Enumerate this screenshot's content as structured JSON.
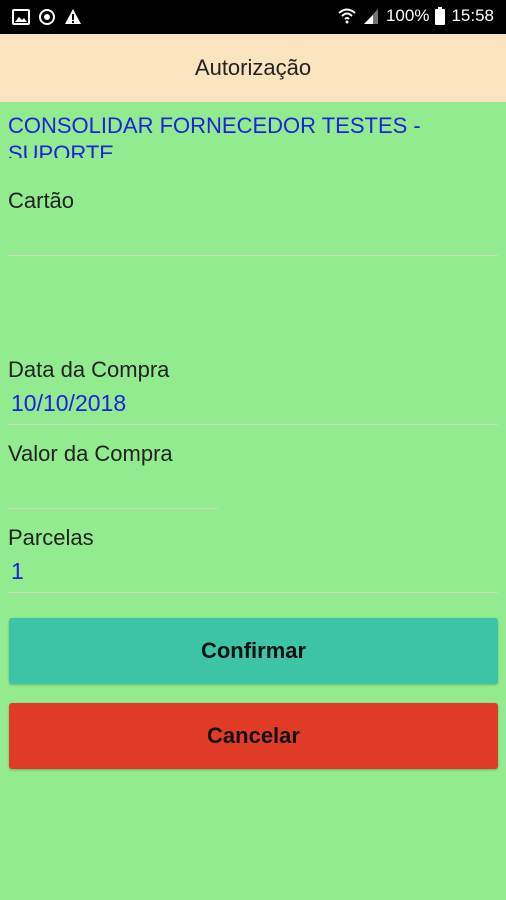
{
  "status_bar": {
    "battery": "100%",
    "time": "15:58",
    "left_icons": [
      "image-icon",
      "sync-icon",
      "warning-icon"
    ],
    "right_icons": [
      "wifi-icon",
      "signal-icon",
      "battery-icon"
    ]
  },
  "app_bar": {
    "title": "Autorização"
  },
  "form": {
    "supplier": "CONSOLIDAR FORNECEDOR TESTES - SUPORTE",
    "card_label": "Cartão",
    "card_value": "",
    "date_label": "Data da Compra",
    "date_value": "10/10/2018",
    "amount_label": "Valor da Compra",
    "amount_value": "",
    "installments_label": "Parcelas",
    "installments_value": "1"
  },
  "buttons": {
    "confirm": "Confirmar",
    "cancel": "Cancelar"
  },
  "colors": {
    "background": "#92ec8f",
    "app_bar": "#fae3bf",
    "value_text": "#1e22d8",
    "confirm": "#3dc3a6",
    "cancel": "#e03b24"
  }
}
